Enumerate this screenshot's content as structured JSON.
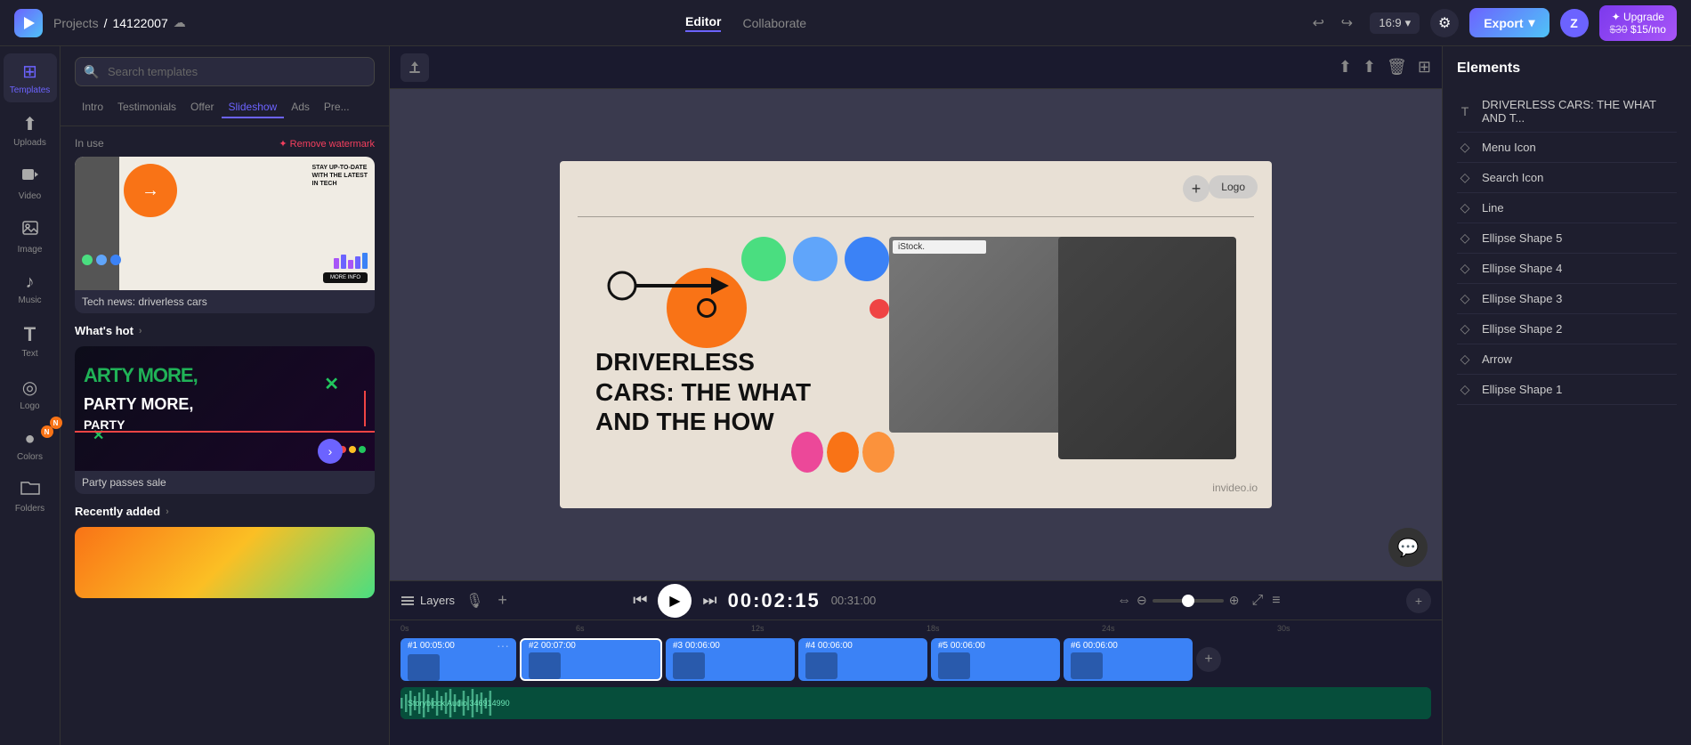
{
  "app": {
    "logo": "▶",
    "project": {
      "label": "Projects",
      "separator": "/",
      "name": "14122007",
      "cloud_icon": "☁"
    }
  },
  "topbar": {
    "undo_label": "↩",
    "redo_label": "↪",
    "aspect_ratio": "16:9",
    "settings_icon": "⚙",
    "export_label": "Export",
    "export_arrow": "▾",
    "avatar_label": "Z",
    "avatar_arrow": "▾",
    "upgrade_label": "✦ Upgrade",
    "price_old": "$30",
    "price_new": "$15/mo",
    "editor_tab": "Editor",
    "collaborate_tab": "Collaborate"
  },
  "icon_nav": {
    "items": [
      {
        "id": "templates",
        "icon": "⊞",
        "label": "Templates",
        "active": true
      },
      {
        "id": "uploads",
        "icon": "↑",
        "label": "Uploads",
        "active": false
      },
      {
        "id": "video",
        "icon": "▶",
        "label": "Video",
        "active": false
      },
      {
        "id": "image",
        "icon": "🖼",
        "label": "Image",
        "active": false
      },
      {
        "id": "music",
        "icon": "♪",
        "label": "Music",
        "active": false
      },
      {
        "id": "text",
        "icon": "T",
        "label": "Text",
        "active": false
      },
      {
        "id": "logo",
        "icon": "◎",
        "label": "Logo",
        "active": false
      },
      {
        "id": "colors",
        "icon": "●",
        "label": "Colors",
        "active": false,
        "badge": "N"
      },
      {
        "id": "folders",
        "icon": "▭",
        "label": "Folders",
        "active": false
      }
    ]
  },
  "templates_panel": {
    "search_placeholder": "Search templates",
    "tabs": [
      {
        "label": "Intro",
        "active": false
      },
      {
        "label": "Testimonials",
        "active": false
      },
      {
        "label": "Offer",
        "active": false
      },
      {
        "label": "Slideshow",
        "active": true
      },
      {
        "label": "Ads",
        "active": false
      },
      {
        "label": "Pre...",
        "active": false
      }
    ],
    "sections": {
      "in_use": {
        "label": "In use",
        "remove_watermark": "✦ Remove watermark",
        "template": {
          "name": "Tech news: driverless cars",
          "checked": true
        }
      },
      "whats_hot": {
        "label": "What's hot",
        "arrow": "›",
        "template": {
          "name": "Party passes sale"
        }
      },
      "recently_added": {
        "label": "Recently added",
        "arrow": "›"
      }
    }
  },
  "canvas": {
    "logo_label": "Logo",
    "add_icon": "+",
    "watermark": "invideo.io",
    "istock": "iStock.",
    "headline1": "DRIVERLESS",
    "headline2": "CARS: THE WHAT",
    "headline3": "AND THE HOW"
  },
  "canvas_toolbar": {
    "upload_icon": "⬆",
    "save_icon": "⬆",
    "delete_icon": "🗑",
    "grid_icon": "⊞"
  },
  "elements_panel": {
    "title": "Elements",
    "items": [
      {
        "id": "driverless-text",
        "icon": "T",
        "label": "DRIVERLESS CARS: THE WHAT AND T..."
      },
      {
        "id": "menu-icon",
        "icon": "◇",
        "label": "Menu Icon"
      },
      {
        "id": "search-icon",
        "icon": "◇",
        "label": "Search Icon"
      },
      {
        "id": "line",
        "icon": "◇",
        "label": "Line"
      },
      {
        "id": "ellipse-5",
        "icon": "◇",
        "label": "Ellipse Shape 5"
      },
      {
        "id": "ellipse-4",
        "icon": "◇",
        "label": "Ellipse Shape 4"
      },
      {
        "id": "ellipse-3",
        "icon": "◇",
        "label": "Ellipse Shape 3"
      },
      {
        "id": "ellipse-2",
        "icon": "◇",
        "label": "Ellipse Shape 2"
      },
      {
        "id": "arrow",
        "icon": "◇",
        "label": "Arrow"
      },
      {
        "id": "ellipse-1",
        "icon": "◇",
        "label": "Ellipse Shape 1"
      }
    ]
  },
  "timeline": {
    "layers_label": "Layers",
    "mic_icon": "🎙",
    "add_icon": "+",
    "play_icon": "▶",
    "prev_icon": "⏮",
    "next_icon": "⏭",
    "current_time": "00:02:15",
    "total_time": "00:31:00",
    "zoom_minus": "⊖",
    "zoom_plus": "⊕",
    "expand_icon": "⇔",
    "settings_icon": "≡",
    "add_track_icon": "+",
    "ruler_marks": [
      "0s",
      "6s",
      "12s",
      "18s",
      "24s",
      "30s"
    ],
    "clips": [
      {
        "id": 1,
        "label": "#1 00:05:00",
        "active": false
      },
      {
        "id": 2,
        "label": "#2 00:07:00",
        "active": true
      },
      {
        "id": 3,
        "label": "#3 00:06:00",
        "active": false
      },
      {
        "id": 4,
        "label": "#4 00:06:00",
        "active": false
      },
      {
        "id": 5,
        "label": "#5 00:06:00",
        "active": false
      },
      {
        "id": 6,
        "label": "#6 00:06:00",
        "active": false
      }
    ],
    "audio_label": "Storyblock Audio 346914990"
  }
}
